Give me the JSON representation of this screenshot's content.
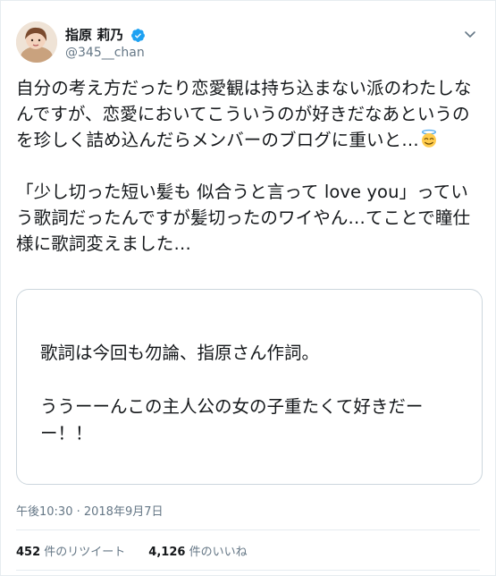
{
  "user": {
    "display_name": "指原 莉乃",
    "handle": "@345__chan"
  },
  "tweet": {
    "text_part1": "自分の考え方だったり恋愛観は持ち込まない派のわたしなんですが、恋愛においてこういうのが好きだなあというのを珍しく詰め込んだらメンバーのブログに重いと…",
    "text_part2": "「少し切った短い髪も 似合うと言って love you」っていう歌詞だったんですが髪切ったのワイやん…てことで瞳仕様に歌詞変えました…",
    "emoji": "smiling-face-with-halo"
  },
  "card": {
    "text": "歌詞は今回も勿論、指原さん作詞。\n\nううーーんこの主人公の女の子重たくて好きだーー！！"
  },
  "meta": {
    "timestamp": "午後10:30 · 2018年9月7日"
  },
  "stats": {
    "retweets_count": "452",
    "retweets_label": "件のリツイート",
    "likes_count": "4,126",
    "likes_label": "件のいいね"
  },
  "colors": {
    "verified": "#1da1f2",
    "muted": "#657786",
    "text": "#14171a",
    "border": "#ccd6dd"
  }
}
